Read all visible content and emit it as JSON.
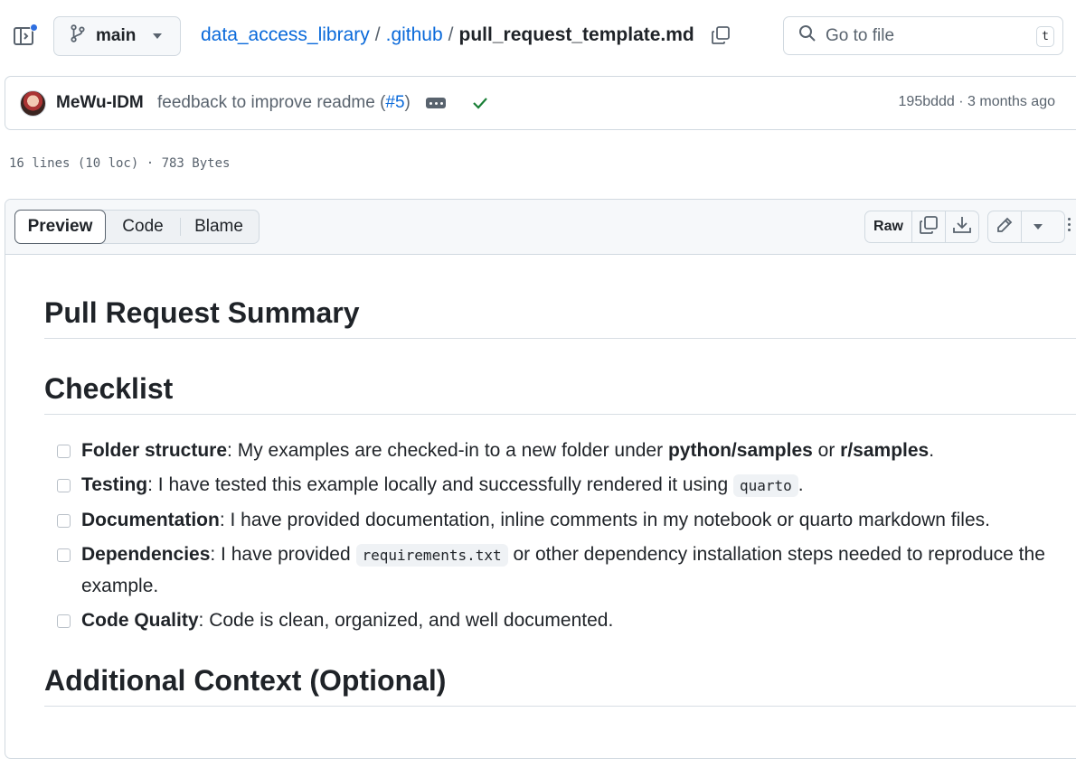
{
  "breadcrumb": {
    "branch": "main",
    "repo": "data_access_library",
    "sep": "/",
    "folder": ".github",
    "file": "pull_request_template.md"
  },
  "search": {
    "placeholder": "Go to file",
    "shortcut": "t"
  },
  "commit": {
    "author": "MeWu-IDM",
    "message": "feedback to improve readme (",
    "pr": "#5",
    "message_end": ")",
    "meta": "195bddd · 3 months ago",
    "status": "success"
  },
  "file_info": "16 lines (10 loc) · 783 Bytes",
  "view_tabs": [
    "Preview",
    "Code",
    "Blame"
  ],
  "toolbar": {
    "raw_label": "Raw"
  },
  "doc": {
    "h1": "Pull Request Summary",
    "h2": "Checklist",
    "h3": "Additional Context (Optional)",
    "tasks": [
      {
        "title": "Folder structure",
        "parts": [
          ": My examples are checked-in to a new folder under ",
          "python/samples",
          " or ",
          "r/samples",
          "."
        ]
      },
      {
        "title": "Testing",
        "parts": [
          ": I have tested this example locally and successfully rendered it using ",
          "quarto",
          "."
        ]
      },
      {
        "title": "Documentation",
        "parts": [
          ": I have provided documentation, inline comments in my notebook or quarto markdown files."
        ]
      },
      {
        "title": "Dependencies",
        "parts": [
          ": I have provided ",
          "requirements.txt",
          " or other dependency installation steps needed to reproduce the",
          "example."
        ]
      },
      {
        "title": "Code Quality",
        "parts": [
          ": Code is clean, organized, and well documented."
        ]
      }
    ]
  },
  "colors": {
    "link": "#0969da",
    "success": "#1a7f37",
    "muted": "#59636e",
    "border": "#d1d9e0"
  }
}
